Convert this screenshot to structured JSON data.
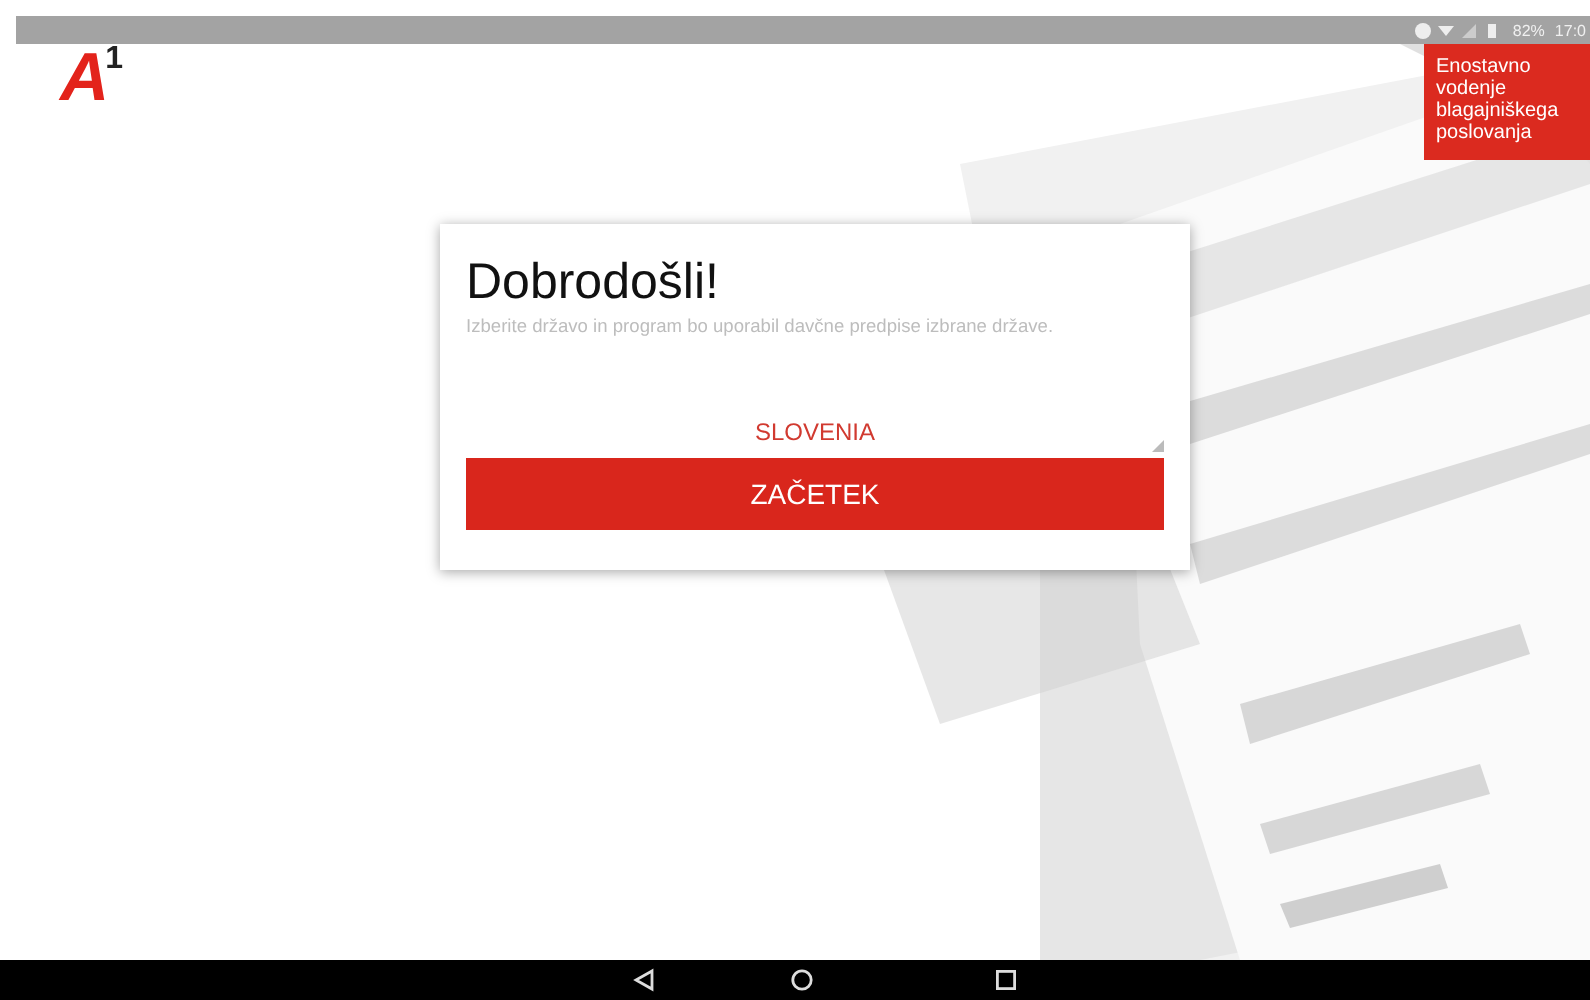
{
  "status_bar": {
    "battery": "82%",
    "time": "17:0"
  },
  "logo": {
    "letter": "A",
    "superscript": "1"
  },
  "banner": {
    "text": "Enostavno vodenje blagajniškega poslovanja"
  },
  "dialog": {
    "title": "Dobrodošli!",
    "subtitle": "Izberite državo in program bo uporabil davčne predpise izbrane države.",
    "country": "SLOVENIA",
    "button": "ZAČETEK"
  },
  "nav_bar": {
    "buttons": [
      {
        "kind": "back"
      },
      {
        "kind": "home"
      },
      {
        "kind": "recents"
      }
    ]
  }
}
